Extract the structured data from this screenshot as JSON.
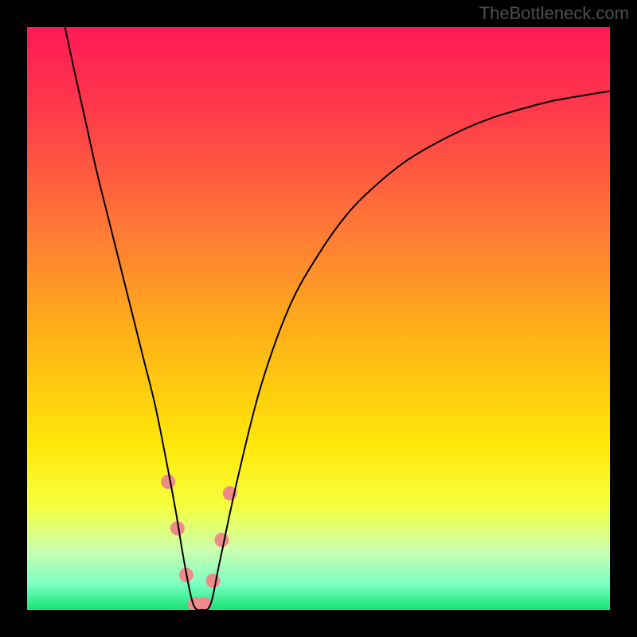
{
  "watermark": "TheBottleneck.com",
  "chart_data": {
    "type": "line",
    "title": "",
    "xlabel": "",
    "ylabel": "",
    "xlim": [
      0,
      100
    ],
    "ylim": [
      0,
      100
    ],
    "grid": false,
    "legend": false,
    "gradient_stops": [
      {
        "pos": 0.0,
        "color": "#ff1a54"
      },
      {
        "pos": 0.15,
        "color": "#ff3b4a"
      },
      {
        "pos": 0.35,
        "color": "#ff7a35"
      },
      {
        "pos": 0.55,
        "color": "#ffb815"
      },
      {
        "pos": 0.72,
        "color": "#ffe80a"
      },
      {
        "pos": 0.82,
        "color": "#f6ff3d"
      },
      {
        "pos": 0.9,
        "color": "#c8ffb0"
      },
      {
        "pos": 0.955,
        "color": "#7dffc3"
      },
      {
        "pos": 1.0,
        "color": "#17e574"
      }
    ],
    "series": [
      {
        "name": "main-curve",
        "stroke": "#000000",
        "stroke_width": 2,
        "x": [
          6.5,
          8,
          10,
          12,
          14,
          16,
          18,
          20,
          22,
          24,
          25.5,
          27,
          28.5,
          30,
          31.5,
          33,
          36,
          40,
          45,
          50,
          55,
          60,
          65,
          70,
          75,
          80,
          85,
          90,
          95,
          100
        ],
        "y": [
          100,
          93,
          84,
          75,
          67,
          59,
          51,
          43,
          35,
          25,
          17,
          8,
          1,
          0,
          1,
          8,
          22,
          38,
          52,
          61,
          68,
          73,
          77,
          80,
          82.5,
          84.5,
          86,
          87.3,
          88.2,
          89
        ]
      }
    ],
    "markers": {
      "name": "highlight-dots",
      "color": "#ef8a8a",
      "radius_px": 9,
      "x": [
        24.2,
        25.8,
        27.3,
        28.8,
        30.4,
        31.9,
        33.4,
        34.8
      ],
      "y": [
        22,
        14,
        6,
        1,
        1,
        5,
        12,
        20
      ]
    }
  }
}
